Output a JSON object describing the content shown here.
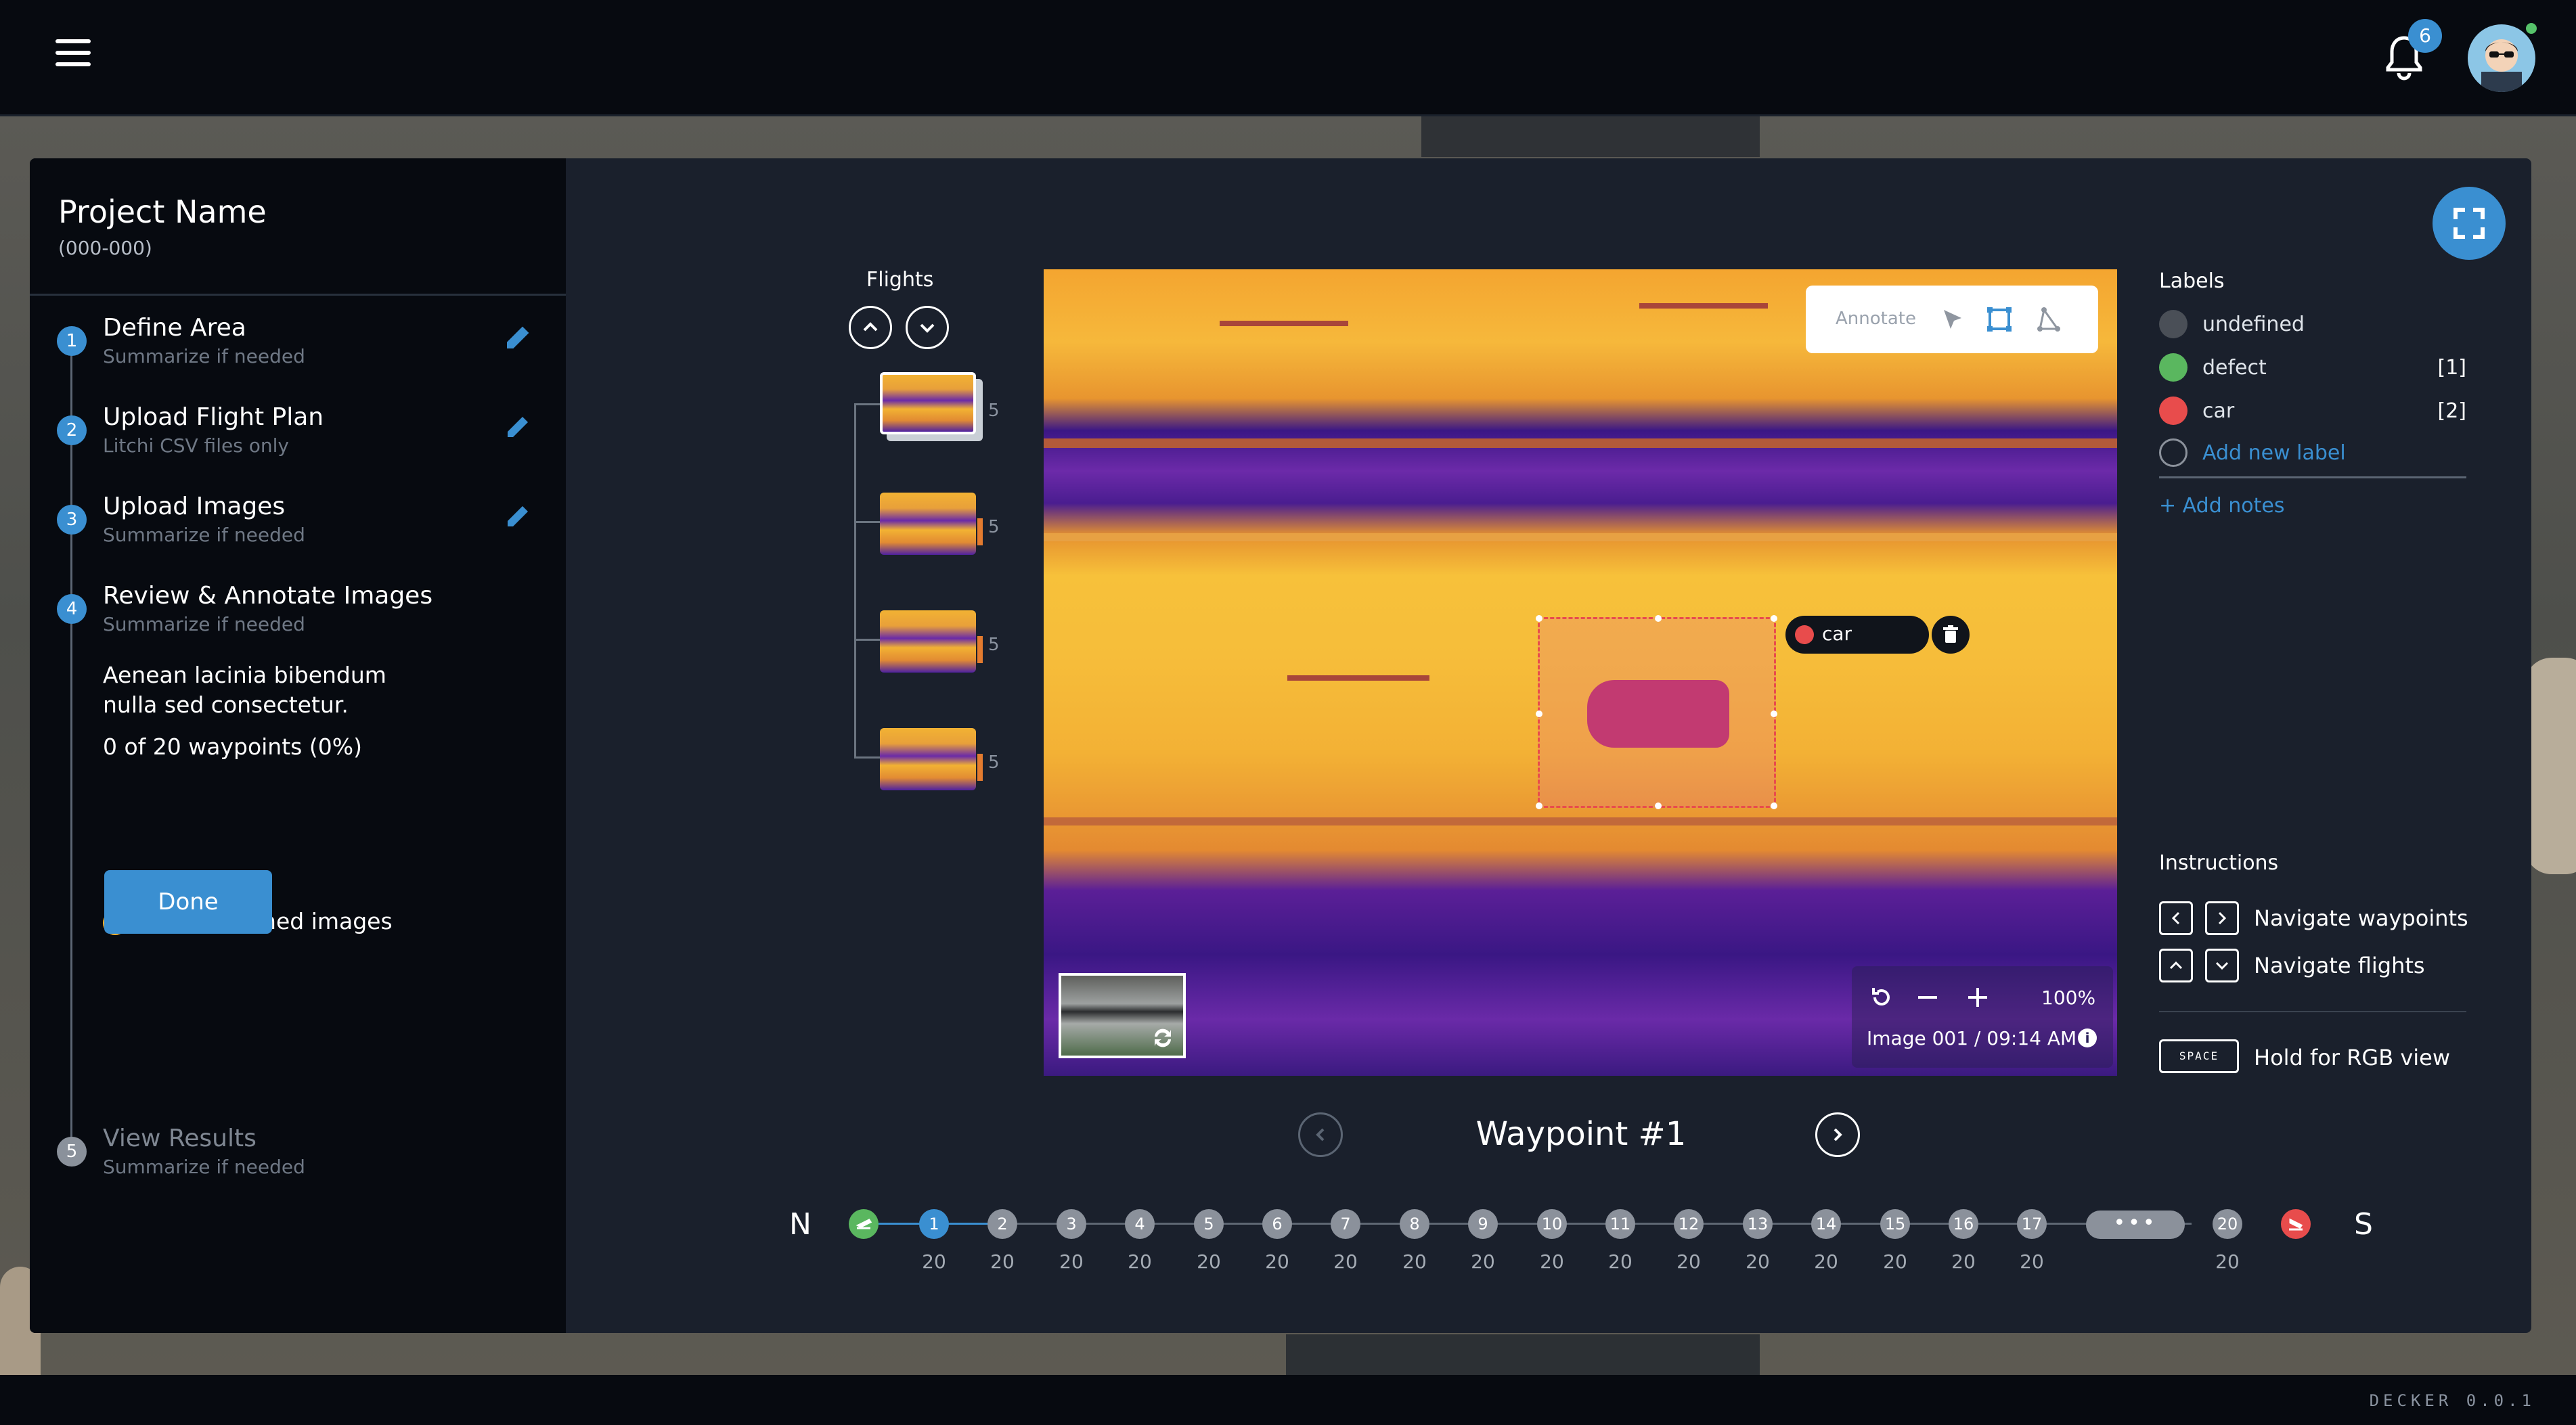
{
  "header": {
    "notifications": "6"
  },
  "project": {
    "name": "Project Name",
    "code": "(000-000)"
  },
  "steps": [
    {
      "num": "1",
      "title": "Define Area",
      "sub": "Summarize if needed"
    },
    {
      "num": "2",
      "title": "Upload Flight Plan",
      "sub": "Litchi CSV files only"
    },
    {
      "num": "3",
      "title": "Upload Images",
      "sub": "Summarize if needed"
    },
    {
      "num": "4",
      "title": "Review & Annotate Images",
      "sub": "Summarize if needed"
    },
    {
      "num": "5",
      "title": "View Results",
      "sub": "Summarize if needed"
    }
  ],
  "review": {
    "desc1": "Aenean lacinia bibendum",
    "desc2": "nulla sed consectetur.",
    "progress": "0 of 20 waypoints (0%)",
    "warning": "10 unassigned images",
    "done_label": "Done"
  },
  "flights": {
    "label": "Flights",
    "items": [
      {
        "count": "5"
      },
      {
        "count": "5"
      },
      {
        "count": "5"
      },
      {
        "count": "5"
      }
    ]
  },
  "annotate": {
    "label": "Annotate"
  },
  "annotation_tag": {
    "label": "car",
    "color": "#e84c4c"
  },
  "viewer": {
    "zoom": "100%",
    "image_info": "Image 001 / 09:14 AM"
  },
  "waypoint": {
    "title": "Waypoint #1"
  },
  "labels": {
    "header": "Labels",
    "items": [
      {
        "name": "undefined",
        "count": "",
        "color": "#4a4f57"
      },
      {
        "name": "defect",
        "count": "[1]",
        "color": "#5ab75f"
      },
      {
        "name": "car",
        "count": "[2]",
        "color": "#e84c4c"
      }
    ],
    "add_label": "Add new label",
    "add_notes": "+ Add notes"
  },
  "instructions": {
    "header": "Instructions",
    "nav_waypoints": "Navigate waypoints",
    "nav_flights": "Navigate flights",
    "space_key": "SPACE",
    "rgb": "Hold for RGB view"
  },
  "timeline": {
    "start": "N",
    "end": "S",
    "waypoints": [
      "1",
      "2",
      "3",
      "4",
      "5",
      "6",
      "7",
      "8",
      "9",
      "10",
      "11",
      "12",
      "13",
      "14",
      "15",
      "16",
      "17"
    ],
    "counts": [
      "20",
      "20",
      "20",
      "20",
      "20",
      "20",
      "20",
      "20",
      "20",
      "20",
      "20",
      "20",
      "20",
      "20",
      "20",
      "20",
      "20"
    ],
    "last": "20",
    "last_count": "20",
    "more": "•••"
  },
  "footer": {
    "version": "DECKER 0.0.1"
  },
  "colors": {
    "accent": "#3a8fd1",
    "warning": "#f2b233",
    "takeoff": "#5ab75f",
    "land": "#e84c4c"
  }
}
